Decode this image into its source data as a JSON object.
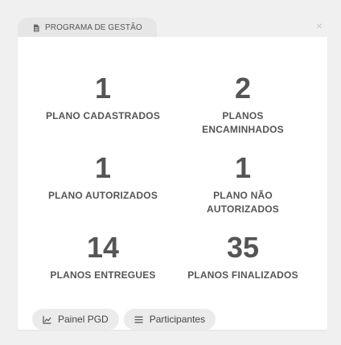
{
  "panel": {
    "tab_title": "PROGRAMA DE GESTÃO",
    "close_glyph": "×"
  },
  "stats": [
    {
      "value": "1",
      "label": "PLANO CADASTRADOS"
    },
    {
      "value": "2",
      "label": "PLANOS ENCAMINHADOS"
    },
    {
      "value": "1",
      "label": "PLANO AUTORIZADOS"
    },
    {
      "value": "1",
      "label": "PLANO NÃO AUTORIZADOS"
    },
    {
      "value": "14",
      "label": "PLANOS ENTREGUES"
    },
    {
      "value": "35",
      "label": "PLANOS FINALIZADOS"
    }
  ],
  "actions": {
    "painel_label": "Painel PGD",
    "participantes_label": "Participantes"
  },
  "icons": {
    "tab": "document-icon",
    "painel": "line-chart-icon",
    "participantes": "list-icon",
    "close": "close-icon"
  },
  "colors": {
    "background": "#f0f0f0",
    "card": "#ffffff",
    "tab": "#e6e6e6",
    "pill": "#ebebeb",
    "text": "#555555"
  }
}
